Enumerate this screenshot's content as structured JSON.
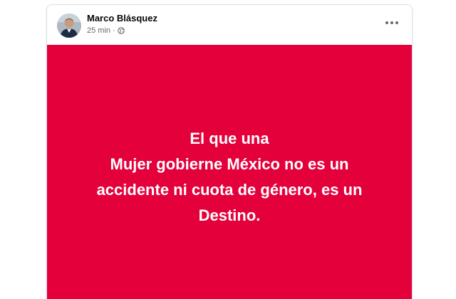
{
  "post": {
    "author": "Marco Blásquez",
    "time": "25 min",
    "separator": "·",
    "audience_icon": "globe-icon",
    "more_icon": "more-options-icon",
    "background_color": "#e4003b",
    "text_color": "#ffffff",
    "text": "El que una\nMujer gobierne México no es un\naccidente ni cuota de género, es un\nDestino."
  }
}
